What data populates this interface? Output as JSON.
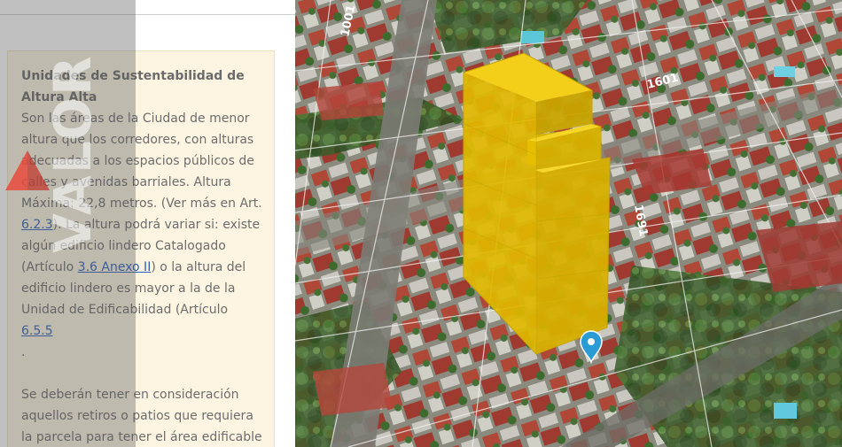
{
  "panel": {
    "title": "Unidades de Sustentabilidad de Altura Alta",
    "paragraph_1": {
      "text_a": "Son las áreas de la Ciudad de menor altura que los corredores, con alturas adecuadas a los espacios públicos de calles y avenidas barriales. Altura Máxima: 22,8 metros. (Ver más en Art. ",
      "link_1": "6.2.3",
      "text_b": "). La altura podrá variar si: existe algún edificio lindero Catalogado (Artículo ",
      "link_2": "3.6 Anexo II",
      "text_c": ") o la altura del edificio lindero es mayor a la de la Unidad de Edificabilidad (Artículo ",
      "link_3": "6.5.5",
      "text_d": "."
    },
    "paragraph_2": "Se deberán tener en consideración aquellos retiros o patios que requiera la parcela para tener el área edificable final"
  },
  "watermark": {
    "text": "VALOR",
    "logo_color": "#e84a3c"
  },
  "map": {
    "street_labels": [
      "1001",
      "1601",
      "1691"
    ],
    "colors": {
      "building": "#ecc300",
      "pin": "#2b9bd6"
    },
    "icons": [
      "location-pin-icon"
    ]
  }
}
